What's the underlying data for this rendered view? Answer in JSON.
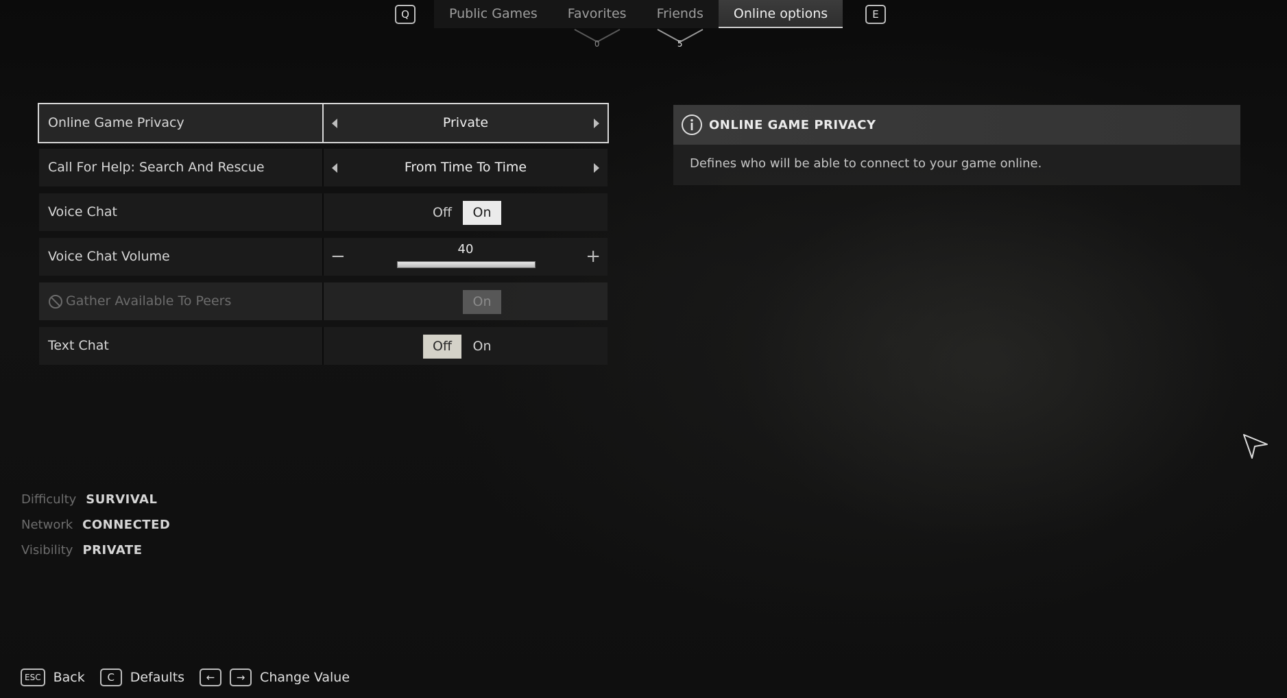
{
  "tabs": {
    "prev_key": "Q",
    "next_key": "E",
    "items": [
      {
        "label": "Public Games",
        "active": false
      },
      {
        "label": "Favorites",
        "active": false,
        "count": "0"
      },
      {
        "label": "Friends",
        "active": false,
        "count": "5"
      },
      {
        "label": "Online options",
        "active": true
      }
    ]
  },
  "settings": [
    {
      "label": "Online Game Privacy",
      "type": "choice",
      "value": "Private",
      "selected": true
    },
    {
      "label": "Call For Help: Search And Rescue",
      "type": "choice",
      "value": "From Time To Time"
    },
    {
      "label": "Voice Chat",
      "type": "toggle",
      "off_label": "Off",
      "on_label": "On",
      "value": "On"
    },
    {
      "label": "Voice Chat Volume",
      "type": "slider",
      "value": "40",
      "fraction": 1.0,
      "minus": "−",
      "plus": "+"
    },
    {
      "label": "Gather Available To Peers",
      "type": "toggle",
      "on_label": "On",
      "value": "On",
      "disabled": true,
      "icon": "blocked-icon"
    },
    {
      "label": "Text Chat",
      "type": "toggle",
      "off_label": "Off",
      "on_label": "On",
      "value": "Off"
    }
  ],
  "info": {
    "icon": "info-icon",
    "title": "ONLINE GAME PRIVACY",
    "description": "Defines who will be able to connect to your game online."
  },
  "status": [
    {
      "key": "Difficulty",
      "value": "SURVIVAL"
    },
    {
      "key": "Network",
      "value": "CONNECTED"
    },
    {
      "key": "Visibility",
      "value": "PRIVATE"
    }
  ],
  "hints": {
    "back_key": "ESC",
    "back_label": "Back",
    "defaults_key": "C",
    "defaults_label": "Defaults",
    "change_left_key": "←",
    "change_right_key": "→",
    "change_label": "Change Value"
  },
  "colors": {
    "background": "#0d0d0d",
    "row": "#1c1c1c",
    "toggle_on": "#ebebeb",
    "toggle_off": "#d4d2c8",
    "accent_text": "#f0f0f0"
  }
}
